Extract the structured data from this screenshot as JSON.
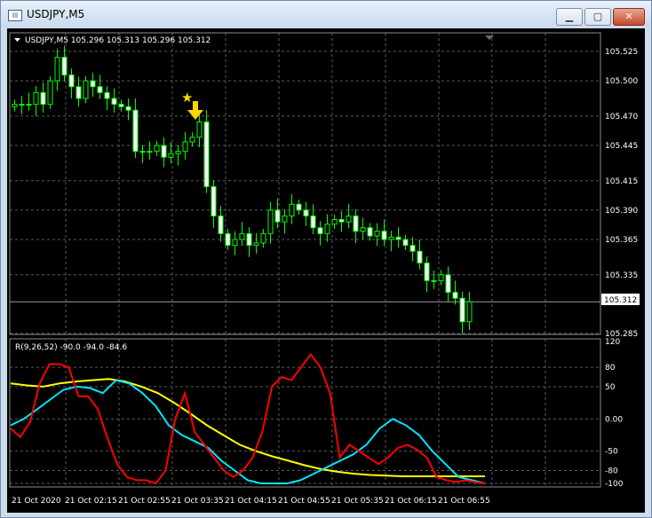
{
  "window": {
    "title": "USDJPY,M5",
    "minimize_glyph": "▁",
    "maximize_glyph": "▢",
    "close_glyph": "✕"
  },
  "chart": {
    "header": "USDJPY,M5  105.296 105.313 105.296 105.312",
    "current_price": "105.312",
    "price_ticks": [
      "105.525",
      "105.500",
      "105.470",
      "105.445",
      "105.415",
      "105.390",
      "105.365",
      "105.335",
      "105.312",
      "105.285"
    ],
    "signal_icons": [
      "star-icon",
      "down-arrow-icon"
    ],
    "colors": {
      "bull_candle": "#00ff00",
      "bear_candle": "#ffffff",
      "grid": "#5a5a5a",
      "signal": "#ffd700"
    }
  },
  "indicator": {
    "label": "R(9,26,52) -90.0 -94.0 -84.6",
    "ticks": [
      "120",
      "80",
      "50",
      "0.00",
      "-50",
      "-80",
      "-100"
    ],
    "colors": {
      "fast": "#ff0000",
      "mid": "#00e5ff",
      "slow": "#ffff00"
    }
  },
  "time_labels": [
    "21 Oct 2020",
    "21 Oct 02:15",
    "21 Oct 02:55",
    "21 Oct 03:35",
    "21 Oct 04:15",
    "21 Oct 04:55",
    "21 Oct 05:35",
    "21 Oct 06:15",
    "21 Oct 06:55"
  ],
  "chart_data": {
    "type": "candlestick",
    "symbol": "USDJPY",
    "timeframe": "M5",
    "ylim": [
      105.285,
      105.525
    ],
    "close": [
      105.48,
      105.48,
      105.48,
      105.49,
      105.48,
      105.5,
      105.52,
      105.505,
      105.495,
      105.485,
      105.5,
      105.495,
      105.49,
      105.485,
      105.48,
      105.478,
      105.475,
      105.44,
      105.44,
      105.44,
      105.445,
      105.435,
      105.438,
      105.44,
      105.448,
      105.452,
      105.465,
      105.41,
      105.385,
      105.37,
      105.36,
      105.365,
      105.37,
      105.36,
      105.362,
      105.37,
      105.39,
      105.38,
      105.385,
      105.395,
      105.39,
      105.385,
      105.375,
      105.37,
      105.378,
      105.382,
      105.38,
      105.385,
      105.372,
      105.375,
      105.368,
      105.372,
      105.365,
      105.367,
      105.365,
      105.36,
      105.355,
      105.345,
      105.33,
      105.33,
      105.335,
      105.32,
      105.315,
      105.295,
      105.312
    ],
    "indicator": {
      "name": "R(9,26,52)",
      "values": [
        -90.0,
        -94.0,
        -84.6
      ],
      "ylim": [
        -100,
        120
      ],
      "fast": [
        -15,
        -28,
        -5,
        55,
        85,
        85,
        80,
        35,
        35,
        15,
        -30,
        -70,
        -90,
        -95,
        -95,
        -100,
        -80,
        0,
        40,
        -20,
        -40,
        -60,
        -80,
        -90,
        -80,
        -60,
        -20,
        50,
        65,
        60,
        80,
        100,
        80,
        40,
        -60,
        -40,
        -50,
        -60,
        -70,
        -60,
        -45,
        -40,
        -48,
        -60,
        -90,
        -95,
        -98,
        -95,
        -98,
        -100
      ],
      "mid": [
        -10,
        0,
        15,
        30,
        45,
        50,
        48,
        40,
        60,
        55,
        40,
        20,
        -10,
        -25,
        -35,
        -45,
        -65,
        -80,
        -95,
        -100,
        -100,
        -100,
        -95,
        -85,
        -75,
        -65,
        -55,
        -40,
        -15,
        0,
        -10,
        -25,
        -50,
        -70,
        -90,
        -95,
        -100
      ],
      "slow": [
        55,
        52,
        50,
        55,
        58,
        60,
        62,
        58,
        50,
        40,
        25,
        8,
        -10,
        -25,
        -40,
        -50,
        -58,
        -65,
        -72,
        -78,
        -82,
        -85,
        -87,
        -88,
        -89,
        -89,
        -89,
        -89,
        -89,
        -89
      ]
    }
  }
}
